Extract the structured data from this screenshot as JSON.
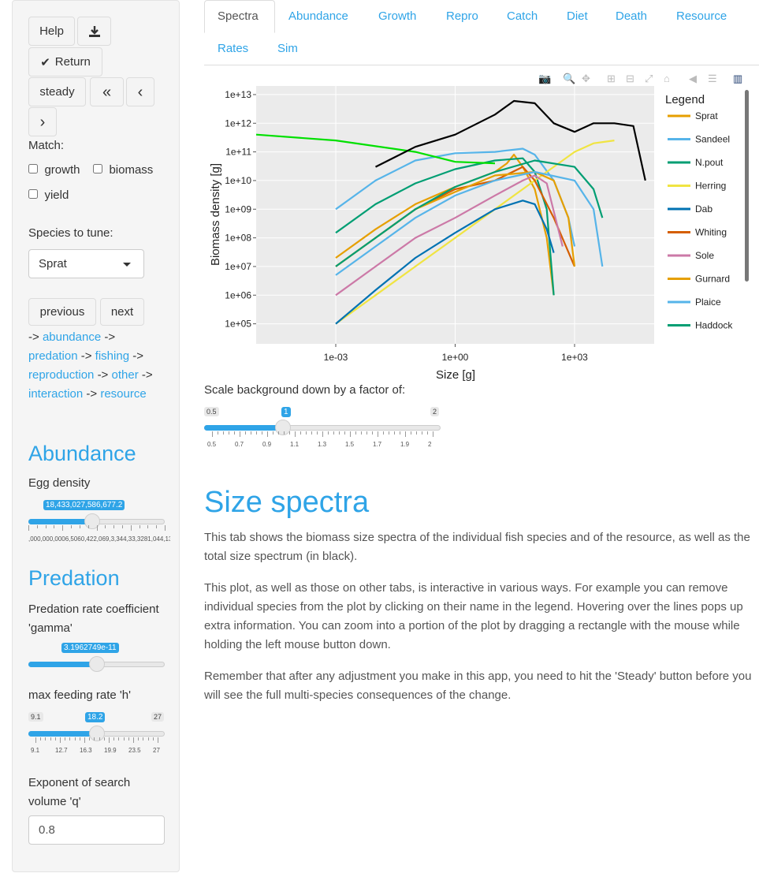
{
  "sidebar": {
    "help_label": "Help",
    "return_label": "Return",
    "steady_label": "steady",
    "match_label": "Match:",
    "match_growth": "growth",
    "match_biomass": "biomass",
    "match_yield": "yield",
    "species_label": "Species to tune:",
    "species_value": "Sprat",
    "previous_label": "previous",
    "next_label": "next",
    "nav": {
      "arrow": "->",
      "abundance": "abundance",
      "predation": "predation",
      "fishing": "fishing",
      "reproduction": "reproduction",
      "other": "other",
      "interaction": "interaction",
      "resource": "resource"
    },
    "abundance_title": "Abundance",
    "egg_density_label": "Egg density",
    "egg_density_value": "18,433,027,586,677.2",
    "egg_density_ticks": [
      ",000,000,000",
      "6,506",
      "0,422,069,",
      "3,344,33,328",
      "1,044,138,683."
    ],
    "egg_density_fraction": 0.47,
    "predation_title": "Predation",
    "gamma_label": "Predation rate coefficient 'gamma'",
    "gamma_value": "3.1962749e-11",
    "gamma_fraction": 0.5,
    "h_label": "max feeding rate 'h'",
    "h_min": "9.1",
    "h_max": "27",
    "h_value": "18.2",
    "h_ticks": [
      "9.1",
      "12.7",
      "16.3",
      "19.9",
      "23.5",
      "27"
    ],
    "h_fraction": 0.5,
    "q_label": "Exponent of search volume 'q'",
    "q_value": "0.8"
  },
  "tabs": [
    "Spectra",
    "Abundance",
    "Growth",
    "Repro",
    "Catch",
    "Diet",
    "Death",
    "Resource",
    "Rates",
    "Sim"
  ],
  "active_tab": "Spectra",
  "modebar_icons": [
    "camera-icon",
    "zoom-icon",
    "pan-icon",
    "zoom-in-icon",
    "zoom-out-icon",
    "autoscale-icon",
    "home-icon",
    "hover-closest-icon",
    "hover-compare-icon",
    "plotly-logo-icon"
  ],
  "chart_data": {
    "type": "line",
    "xlabel": "Size [g]",
    "ylabel": "Biomass density [g]",
    "x_scale": "log",
    "y_scale": "log",
    "x_ticks": [
      "1e-03",
      "1e+00",
      "1e+03"
    ],
    "y_ticks": [
      "1e+13",
      "1e+12",
      "1e+11",
      "1e+10",
      "1e+09",
      "1e+08",
      "1e+07",
      "1e+06",
      "1e+05"
    ],
    "xlim": [
      1e-05,
      100000.0
    ],
    "ylim": [
      20000.0,
      20000000000000.0
    ],
    "legend_title": "Legend",
    "legend_position": "right",
    "series": [
      {
        "name": "Sprat",
        "color": "#e69f00",
        "points": [
          [
            0.001,
            20000000.0
          ],
          [
            0.01,
            200000000.0
          ],
          [
            0.1,
            1500000000.0
          ],
          [
            1,
            6000000000.0
          ],
          [
            10,
            20000000000.0
          ],
          [
            20,
            40000000000.0
          ],
          [
            30,
            80000000000.0
          ],
          [
            50,
            30000000000.0
          ],
          [
            100,
            5000000000.0
          ],
          [
            200,
            100000000.0
          ],
          [
            300,
            1000000.0
          ]
        ]
      },
      {
        "name": "Sandeel",
        "color": "#56b4e9",
        "points": [
          [
            0.001,
            1000000000.0
          ],
          [
            0.01,
            10000000000.0
          ],
          [
            0.1,
            50000000000.0
          ],
          [
            1,
            90000000000.0
          ],
          [
            10,
            100000000000.0
          ],
          [
            50,
            130000000000.0
          ],
          [
            100,
            80000000000.0
          ],
          [
            300,
            10000000000.0
          ],
          [
            700,
            500000000.0
          ],
          [
            1000,
            50000000.0
          ]
        ]
      },
      {
        "name": "N.pout",
        "color": "#009e73",
        "points": [
          [
            0.001,
            150000000.0
          ],
          [
            0.01,
            1500000000.0
          ],
          [
            0.1,
            8000000000.0
          ],
          [
            1,
            25000000000.0
          ],
          [
            10,
            50000000000.0
          ],
          [
            50,
            60000000000.0
          ],
          [
            100,
            20000000000.0
          ],
          [
            200,
            1000000000.0
          ],
          [
            300,
            1000000.0
          ]
        ]
      },
      {
        "name": "Herring",
        "color": "#f0e442",
        "points": [
          [
            0.001,
            100000.0
          ],
          [
            0.01,
            1000000.0
          ],
          [
            0.1,
            10000000.0
          ],
          [
            1,
            100000000.0
          ],
          [
            10,
            1000000000.0
          ],
          [
            100,
            10000000000.0
          ],
          [
            1000,
            100000000000.0
          ],
          [
            3000,
            200000000000.0
          ],
          [
            10000,
            250000000000.0
          ]
        ]
      },
      {
        "name": "Dab",
        "color": "#0072b2",
        "points": [
          [
            0.001,
            100000.0
          ],
          [
            0.01,
            1500000.0
          ],
          [
            0.1,
            20000000.0
          ],
          [
            1,
            150000000.0
          ],
          [
            10,
            1000000000.0
          ],
          [
            50,
            2000000000.0
          ],
          [
            100,
            1500000000.0
          ],
          [
            200,
            200000000.0
          ],
          [
            300,
            30000000.0
          ]
        ]
      },
      {
        "name": "Whiting",
        "color": "#d55e00",
        "points": [
          [
            0.001,
            10000000.0
          ],
          [
            0.01,
            100000000.0
          ],
          [
            0.1,
            1000000000.0
          ],
          [
            1,
            5000000000.0
          ],
          [
            10,
            10000000000.0
          ],
          [
            50,
            30000000000.0
          ],
          [
            100,
            10000000000.0
          ],
          [
            300,
            500000000.0
          ],
          [
            1000,
            10000000.0
          ]
        ]
      },
      {
        "name": "Sole",
        "color": "#cc79a7",
        "points": [
          [
            0.001,
            1000000.0
          ],
          [
            0.01,
            10000000.0
          ],
          [
            0.1,
            100000000.0
          ],
          [
            1,
            500000000.0
          ],
          [
            10,
            3000000000.0
          ],
          [
            50,
            10000000000.0
          ],
          [
            100,
            15000000000.0
          ],
          [
            200,
            8000000000.0
          ],
          [
            500,
            50000000.0
          ]
        ]
      },
      {
        "name": "Gurnard",
        "color": "#e69f00",
        "points": [
          [
            0.001,
            10000000.0
          ],
          [
            0.01,
            100000000.0
          ],
          [
            0.1,
            1000000000.0
          ],
          [
            1,
            4000000000.0
          ],
          [
            10,
            15000000000.0
          ],
          [
            100,
            20000000000.0
          ],
          [
            300,
            10000000000.0
          ],
          [
            700,
            500000000.0
          ],
          [
            1000,
            10000000.0
          ]
        ]
      },
      {
        "name": "Plaice",
        "color": "#56b4e9",
        "points": [
          [
            0.001,
            5000000.0
          ],
          [
            0.01,
            50000000.0
          ],
          [
            0.1,
            500000000.0
          ],
          [
            1,
            3000000000.0
          ],
          [
            10,
            10000000000.0
          ],
          [
            100,
            20000000000.0
          ],
          [
            1000,
            10000000000.0
          ],
          [
            3000,
            1000000000.0
          ],
          [
            5000,
            10000000.0
          ]
        ]
      },
      {
        "name": "Haddock",
        "color": "#009e73",
        "points": [
          [
            0.001,
            10000000.0
          ],
          [
            0.01,
            100000000.0
          ],
          [
            0.1,
            1000000000.0
          ],
          [
            1,
            6000000000.0
          ],
          [
            10,
            20000000000.0
          ],
          [
            100,
            50000000000.0
          ],
          [
            1000,
            30000000000.0
          ],
          [
            3000,
            5000000000.0
          ],
          [
            5000,
            500000000.0
          ]
        ]
      },
      {
        "name": "Resource",
        "color": "#00e000",
        "points": [
          [
            1e-05,
            400000000000.0
          ],
          [
            0.001,
            250000000000.0
          ],
          [
            0.1,
            100000000000.0
          ],
          [
            1,
            45000000000.0
          ],
          [
            10,
            40000000000.0
          ]
        ]
      },
      {
        "name": "Total",
        "color": "#000000",
        "points": [
          [
            0.01,
            30000000000.0
          ],
          [
            0.1,
            150000000000.0
          ],
          [
            1,
            400000000000.0
          ],
          [
            10,
            2000000000000.0
          ],
          [
            30,
            6000000000000.0
          ],
          [
            100,
            5000000000000.0
          ],
          [
            300,
            1000000000000.0
          ],
          [
            1000,
            500000000000.0
          ],
          [
            3000,
            1000000000000.0
          ],
          [
            10000,
            1000000000000.0
          ],
          [
            30000,
            800000000000.0
          ],
          [
            60000,
            10000000000.0
          ]
        ]
      }
    ]
  },
  "scale": {
    "label": "Scale background down by a factor of:",
    "min": "0.5",
    "max": "2",
    "value": "1",
    "fraction": 0.333,
    "ticks": [
      "0.5",
      "0.7",
      "0.9",
      "1.1",
      "1.3",
      "1.5",
      "1.7",
      "1.9",
      "2"
    ]
  },
  "content": {
    "title": "Size spectra",
    "p1": "This tab shows the biomass size spectra of the individual fish species and of the resource, as well as the total size spectrum (in black).",
    "p2": "This plot, as well as those on other tabs, is interactive in various ways. For example you can remove individual species from the plot by clicking on their name in the legend. Hovering over the lines pops up extra information. You can zoom into a portion of the plot by dragging a rectangle with the mouse while holding the left mouse button down.",
    "p3": "Remember that after any adjustment you make in this app, you need to hit the 'Steady' button before you will see the full multi-species consequences of the change."
  }
}
